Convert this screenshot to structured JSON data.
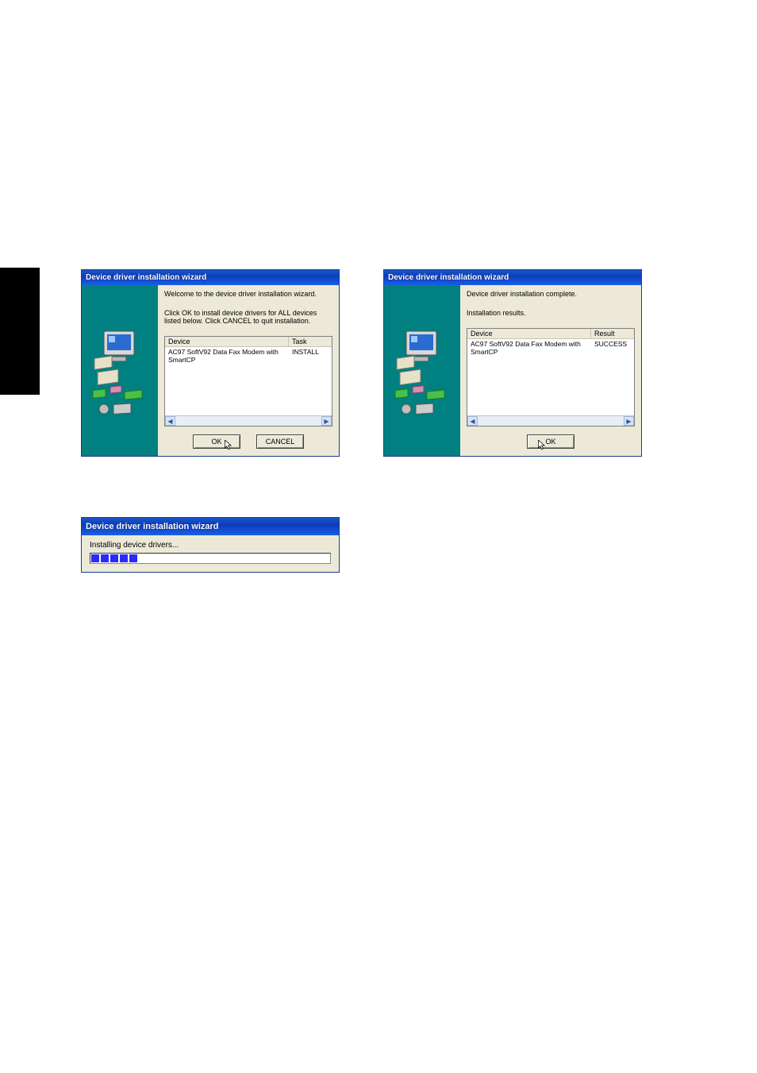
{
  "dialog1": {
    "title": "Device driver installation wizard",
    "welcome": "Welcome to the device driver installation wizard.",
    "instruction": "Click OK to install device drivers for ALL devices listed below. Click CANCEL to quit installation.",
    "col_device": "Device",
    "col_task": "Task",
    "row_device": "AC97 SoftV92 Data Fax Modem with SmartCP",
    "row_task": "INSTALL",
    "ok": "OK",
    "cancel": "CANCEL"
  },
  "dialog2": {
    "title": "Device driver installation wizard",
    "complete": "Device driver installation complete.",
    "results_label": "Installation results.",
    "col_device": "Device",
    "col_result": "Result",
    "row_device": "AC97 SoftV92 Data Fax Modem with SmartCP",
    "row_result": "SUCCESS",
    "ok": "OK"
  },
  "dialog3": {
    "title": "Device driver installation wizard",
    "status": "Installing device drivers...",
    "progress_chunks": 5
  }
}
